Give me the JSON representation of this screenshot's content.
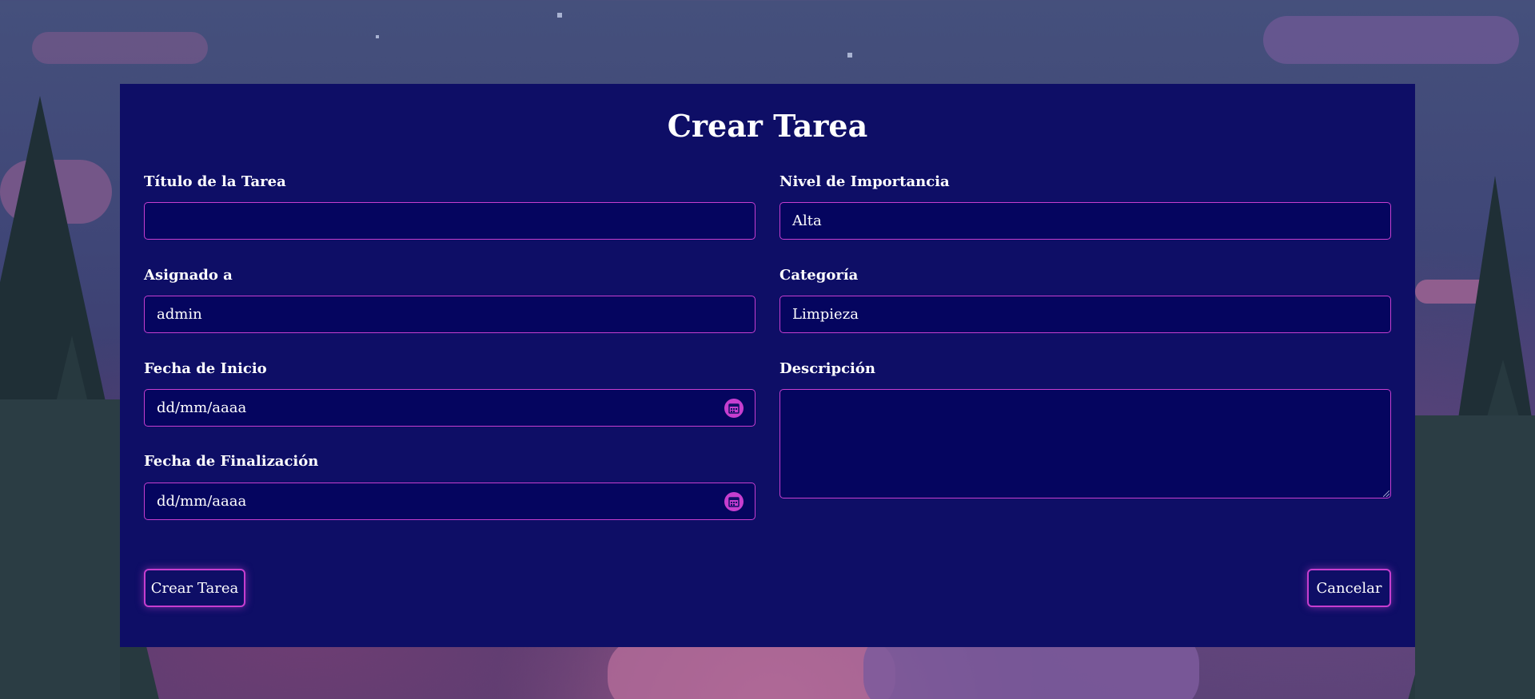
{
  "form": {
    "title": "Crear Tarea",
    "fields": {
      "titulo": {
        "label": "Título de la Tarea",
        "value": ""
      },
      "importancia": {
        "label": "Nivel de Importancia",
        "value": "Alta"
      },
      "asignado": {
        "label": "Asignado a",
        "value": "admin"
      },
      "categoria": {
        "label": "Categoría",
        "value": "Limpieza"
      },
      "fecha_inicio": {
        "label": "Fecha de Inicio",
        "placeholder": "dd/mm/aaaa"
      },
      "descripcion": {
        "label": "Descripción",
        "value": ""
      },
      "fecha_fin": {
        "label": "Fecha de Finalización",
        "placeholder": "dd/mm/aaaa"
      }
    },
    "buttons": {
      "submit": "Crear Tarea",
      "cancel": "Cancelar"
    }
  },
  "icons": {
    "date_picker": "calendar-icon"
  },
  "colors": {
    "panel": "#0e0e66",
    "input_bg": "#05055f",
    "accent": "#c63ecf",
    "text": "#ffffff"
  }
}
